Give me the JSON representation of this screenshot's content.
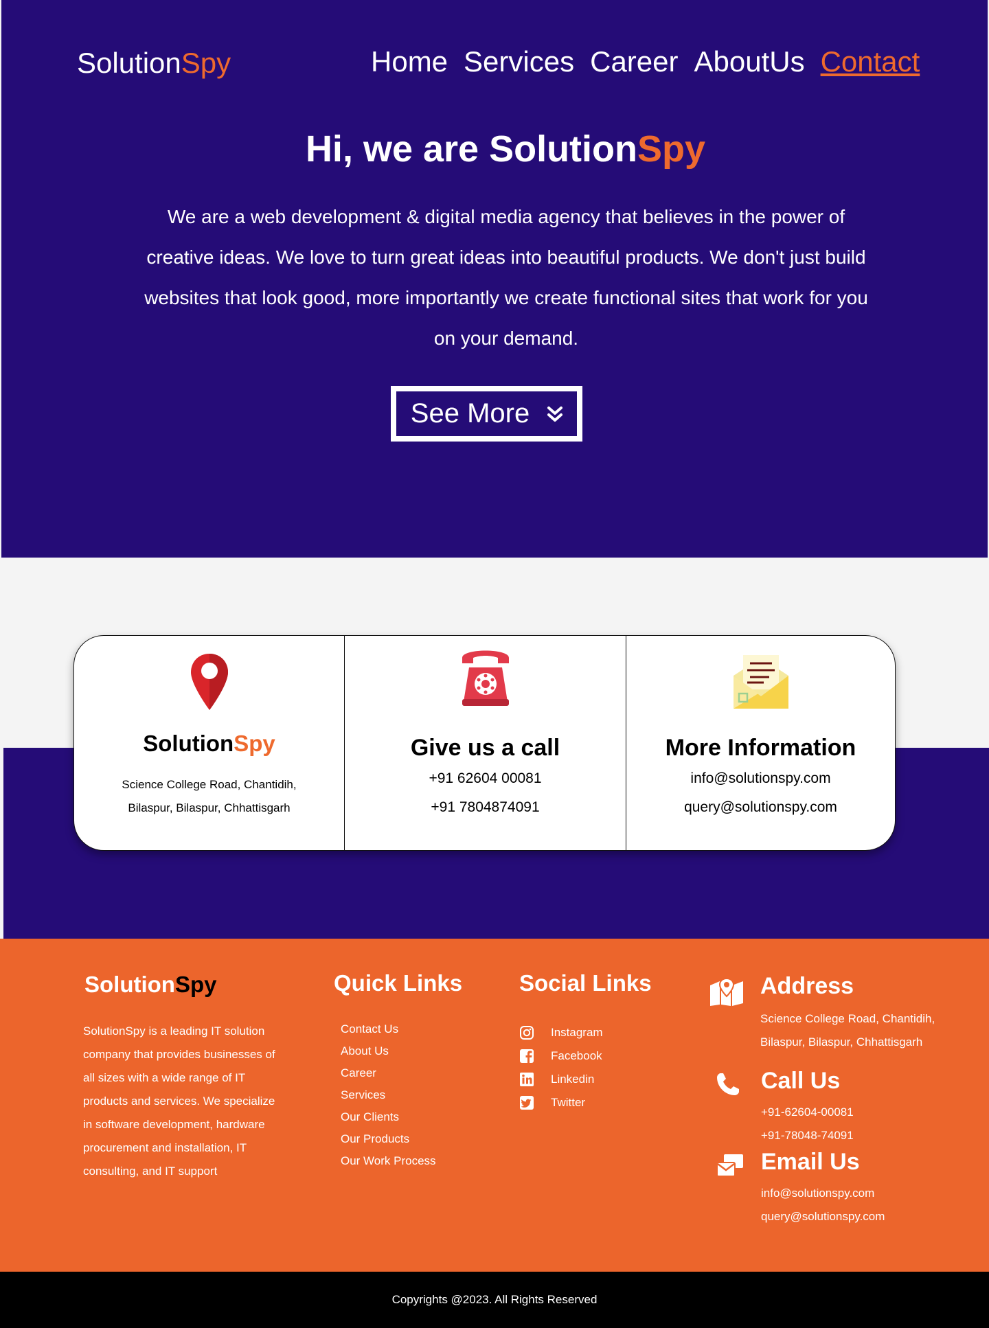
{
  "header": {
    "brand_part1": "Solution",
    "brand_part2": "Spy",
    "nav": [
      "Home",
      "Services",
      "Career",
      "AboutUs",
      "Contact"
    ]
  },
  "hero": {
    "title_prefix": "Hi, we are Solution",
    "title_suffix": "Spy",
    "text": "We are a web development & digital media agency that believes in the power of creative ideas. We love to turn great ideas into beautiful products. We don't just build websites that look good, more importantly we create functional sites that work for you on your demand.",
    "button_label": "See More"
  },
  "cards": {
    "location": {
      "icon": "map-pin-icon",
      "title_part1": "Solution",
      "title_part2": "Spy",
      "line1": "Science College Road, Chantidih,",
      "line2": "Bilaspur, Bilaspur, Chhattisgarh"
    },
    "call": {
      "icon": "telephone-icon",
      "title": "Give us a call",
      "phone1": "+91 62604 00081",
      "phone2": "+91 7804874091"
    },
    "info": {
      "icon": "envelope-icon",
      "title": "More Information",
      "email1": "info@solutionspy.com",
      "email2": "query@solutionspy.com"
    }
  },
  "footer": {
    "brand_part1": "Solution",
    "brand_part2": "Spy",
    "about": "SolutionSpy is a leading IT solution company that provides businesses of all sizes with a wide range of IT products and services. We specialize in software development, hardware procurement and installation, IT consulting, and IT support",
    "quick_links_title": "Quick Links",
    "quick_links": [
      "Contact Us",
      "About Us",
      "Career",
      "Services",
      "Our Clients",
      "Our Products",
      "Our Work Process"
    ],
    "social_title": "Social Links",
    "social": [
      {
        "label": "Instagram",
        "icon": "instagram-icon"
      },
      {
        "label": "Facebook",
        "icon": "facebook-icon"
      },
      {
        "label": "Linkedin",
        "icon": "linkedin-icon"
      },
      {
        "label": "Twitter",
        "icon": "twitter-icon"
      }
    ],
    "address_title": "Address",
    "address_line1": "Science College Road, Chantidih,",
    "address_line2": "Bilaspur, Bilaspur, Chhattisgarh",
    "call_title": "Call Us",
    "call_line1": "+91-62604-00081",
    "call_line2": "+91-78048-74091",
    "email_title": "Email Us",
    "email_line1": "info@solutionspy.com",
    "email_line2": "query@solutionspy.com"
  },
  "copyright": "Copyrights @2023. All Rights Reserved",
  "colors": {
    "primary": "#250c77",
    "accent": "#ee6a2e",
    "footer": "#ec652c"
  }
}
